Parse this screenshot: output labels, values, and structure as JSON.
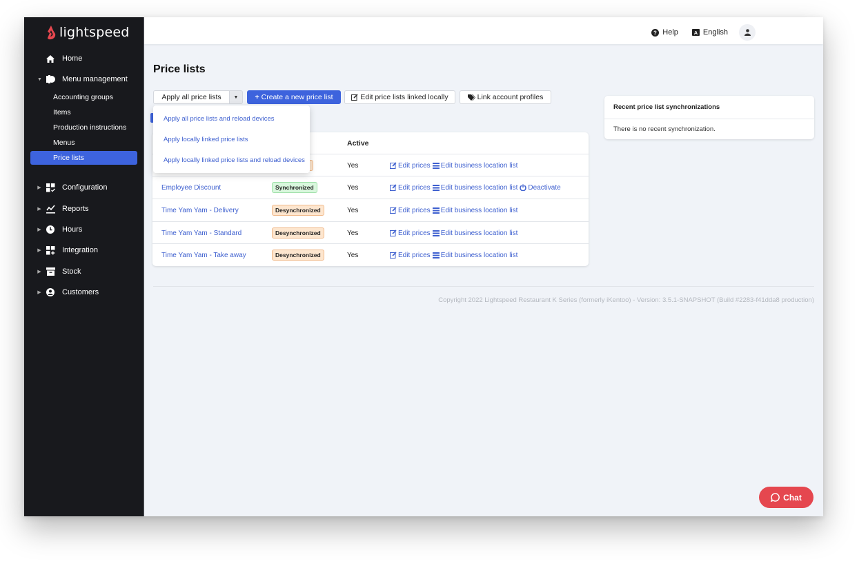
{
  "app": {
    "brand": "lightspeed",
    "colors": {
      "accent": "#3d63dd",
      "sidebar_bg": "#18191d",
      "chat": "#e5474f",
      "logo": "#e5474f",
      "link": "#3d5fcf"
    }
  },
  "topbar": {
    "help_label": "Help",
    "help_icon": "question-circle-icon",
    "language_label": "English",
    "language_icon": "language-icon",
    "account_icon": "user-icon"
  },
  "sidebar": {
    "items": [
      {
        "label": "Home",
        "icon": "home-icon",
        "expanded": null
      },
      {
        "label": "Menu management",
        "icon": "menu-management-icon",
        "expanded": true,
        "children": [
          {
            "label": "Accounting groups",
            "active": false
          },
          {
            "label": "Items",
            "active": false
          },
          {
            "label": "Production instructions",
            "active": false
          },
          {
            "label": "Menus",
            "active": false
          },
          {
            "label": "Price lists",
            "active": true
          }
        ]
      },
      {
        "label": "Configuration",
        "icon": "configuration-icon",
        "expanded": false
      },
      {
        "label": "Reports",
        "icon": "reports-icon",
        "expanded": false
      },
      {
        "label": "Hours",
        "icon": "clock-icon",
        "expanded": false
      },
      {
        "label": "Integration",
        "icon": "integration-icon",
        "expanded": false
      },
      {
        "label": "Stock",
        "icon": "stock-icon",
        "expanded": false
      },
      {
        "label": "Customers",
        "icon": "customers-icon",
        "expanded": false
      }
    ]
  },
  "main": {
    "title": "Price lists",
    "toolbar": {
      "apply_label": "Apply all price lists",
      "create_label": "Create a new price list",
      "edit_local_label": "Edit price lists linked locally",
      "link_profiles_label": "Link account profiles"
    },
    "apply_dropdown": {
      "open": true,
      "options": [
        "Apply all price lists and reload devices",
        "Apply locally linked price lists",
        "Apply locally linked price lists and reload devices"
      ]
    },
    "table": {
      "columns": [
        "",
        "",
        "Active",
        ""
      ],
      "rows": [
        {
          "name": "",
          "status": "d",
          "status_type": "desync",
          "active": "Yes",
          "actions": [
            "Edit prices",
            "Edit business location list"
          ]
        },
        {
          "name": "Employee Discount",
          "status": "Synchronized",
          "status_type": "sync",
          "active": "Yes",
          "actions": [
            "Edit prices",
            "Edit business location list",
            "Deactivate"
          ]
        },
        {
          "name": "Time Yam Yam - Delivery",
          "status": "Desynchronized",
          "status_type": "desync",
          "active": "Yes",
          "actions": [
            "Edit prices",
            "Edit business location list"
          ]
        },
        {
          "name": "Time Yam Yam - Standard",
          "status": "Desynchronized",
          "status_type": "desync",
          "active": "Yes",
          "actions": [
            "Edit prices",
            "Edit business location list"
          ]
        },
        {
          "name": "Time Yam Yam - Take away",
          "status": "Desynchronized",
          "status_type": "desync",
          "active": "Yes",
          "actions": [
            "Edit prices",
            "Edit business location list"
          ]
        }
      ]
    },
    "sync_panel": {
      "title": "Recent price list synchronizations",
      "empty_text": "There is no recent synchronization."
    },
    "footer": "Copyright 2022 Lightspeed Restaurant K Series (formerly iKentoo) - Version: 3.5.1-SNAPSHOT (Build #2283-f41dda8 production)"
  },
  "chat": {
    "label": "Chat"
  }
}
